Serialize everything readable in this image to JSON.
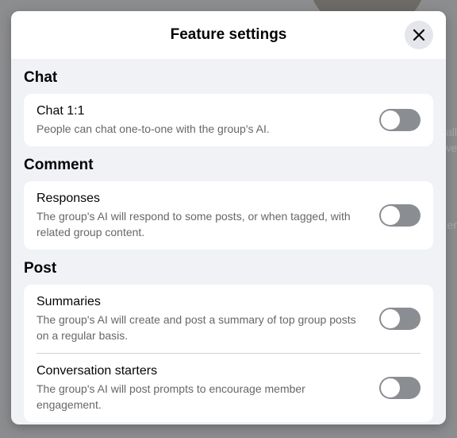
{
  "modal": {
    "title": "Feature settings",
    "close_icon": "close-icon"
  },
  "sections": [
    {
      "title": "Chat",
      "items": [
        {
          "label": "Chat 1:1",
          "description": "People can chat one-to-one with the group's AI.",
          "enabled": false
        }
      ]
    },
    {
      "title": "Comment",
      "items": [
        {
          "label": "Responses",
          "description": "The group's AI will respond to some posts, or when tagged, with related group content.",
          "enabled": false
        }
      ]
    },
    {
      "title": "Post",
      "items": [
        {
          "label": "Summaries",
          "description": "The group's AI will create and post a summary of top group posts on a regular basis.",
          "enabled": false
        },
        {
          "label": "Conversation starters",
          "description": "The group's AI will post prompts to encourage member engagement.",
          "enabled": false
        }
      ]
    }
  ],
  "colors": {
    "toggle_off": "#8a8d91",
    "modal_bg": "#f0f2f5",
    "card_bg": "#ffffff",
    "secondary_text": "#65676b"
  }
}
